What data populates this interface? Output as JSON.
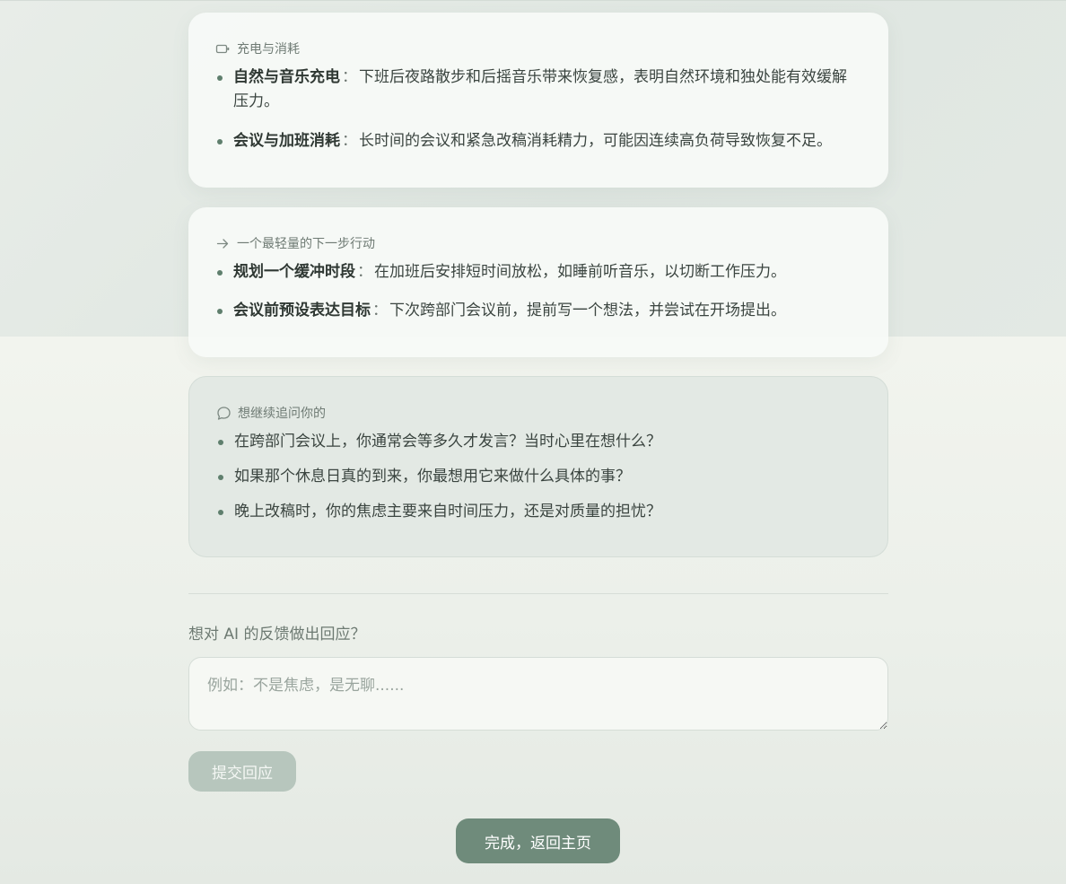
{
  "sections": [
    {
      "icon": "battery-icon",
      "title": "充电与消耗",
      "items": [
        {
          "title": "自然与音乐充电",
          "separator": "：",
          "text": "下班后夜路散步和后摇音乐带来恢复感，表明自然环境和独处能有效缓解压力。"
        },
        {
          "title": "会议与加班消耗",
          "separator": "：",
          "text": "长时间的会议和紧急改稿消耗精力，可能因连续高负荷导致恢复不足。"
        }
      ]
    },
    {
      "icon": "arrow-right-icon",
      "title": "一个最轻量的下一步行动",
      "items": [
        {
          "title": "规划一个缓冲时段",
          "separator": "：",
          "text": "在加班后安排短时间放松，如睡前听音乐，以切断工作压力。"
        },
        {
          "title": "会议前预设表达目标",
          "separator": "：",
          "text": "下次跨部门会议前，提前写一个想法，并尝试在开场提出。"
        }
      ]
    },
    {
      "icon": "chat-bubble-icon",
      "title": "想继续追问你的",
      "questions": [
        "在跨部门会议上，你通常会等多久才发言？当时心里在想什么？",
        "如果那个休息日真的到来，你最想用它来做什么具体的事？",
        "晚上改稿时，你的焦虑主要来自时间压力，还是对质量的担忧？"
      ]
    }
  ],
  "feedback": {
    "label": "想对 AI 的反馈做出回应？",
    "placeholder": "例如：不是焦虑，是无聊......",
    "value": "",
    "submit_label": "提交回应"
  },
  "done_label": "完成，返回主页",
  "colors": {
    "accent": "#6f8b7b",
    "bullet": "#5f7f6d",
    "submit_disabled": "#b7c6bd",
    "card_bg": "#f8faf7",
    "question_card_bg": "#e3e9e4"
  }
}
